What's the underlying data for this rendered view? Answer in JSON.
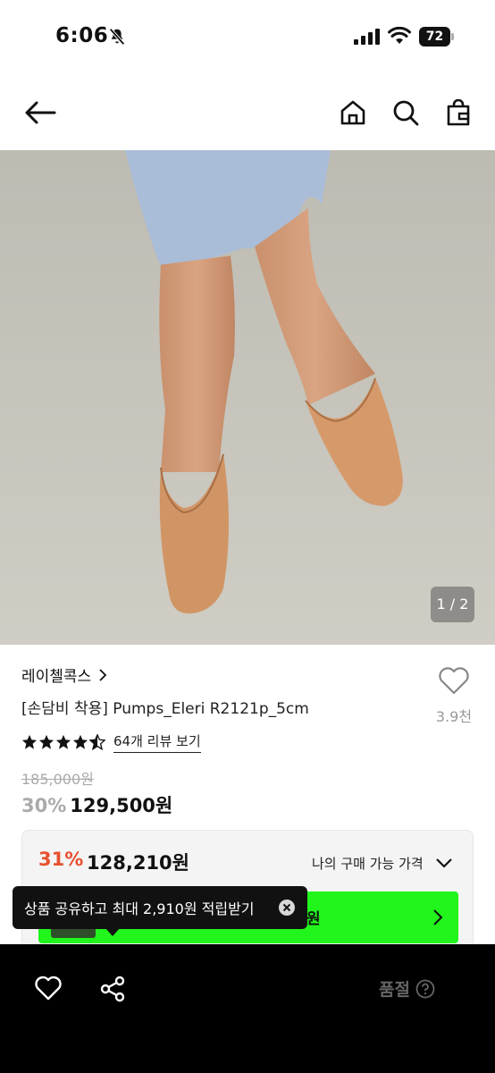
{
  "status_bar": {
    "time": "6:06",
    "battery": "72"
  },
  "product": {
    "image_counter": "1 / 2",
    "brand": "레이첼콕스",
    "name": "[손담비 착용] Pumps_Eleri R2121p_5cm",
    "like_count": "3.9천",
    "rating": 4.5,
    "review_link": "64개 리뷰 보기",
    "original_price": "185,000원",
    "discount_percent": "30%",
    "sale_price": "129,500원"
  },
  "purchase_box": {
    "discount_percent": "31%",
    "price": "128,210원",
    "label": "나의 구매 가능 가격",
    "green_button_text": "원"
  },
  "tooltip": {
    "text": "상품 공유하고 최대 2,910원 적립받기"
  },
  "bottom_bar": {
    "sold_out_label": "품절"
  },
  "colors": {
    "accent_discount": "#e8502f",
    "green_button": "#21f51c",
    "bottom_bar": "#000000"
  }
}
